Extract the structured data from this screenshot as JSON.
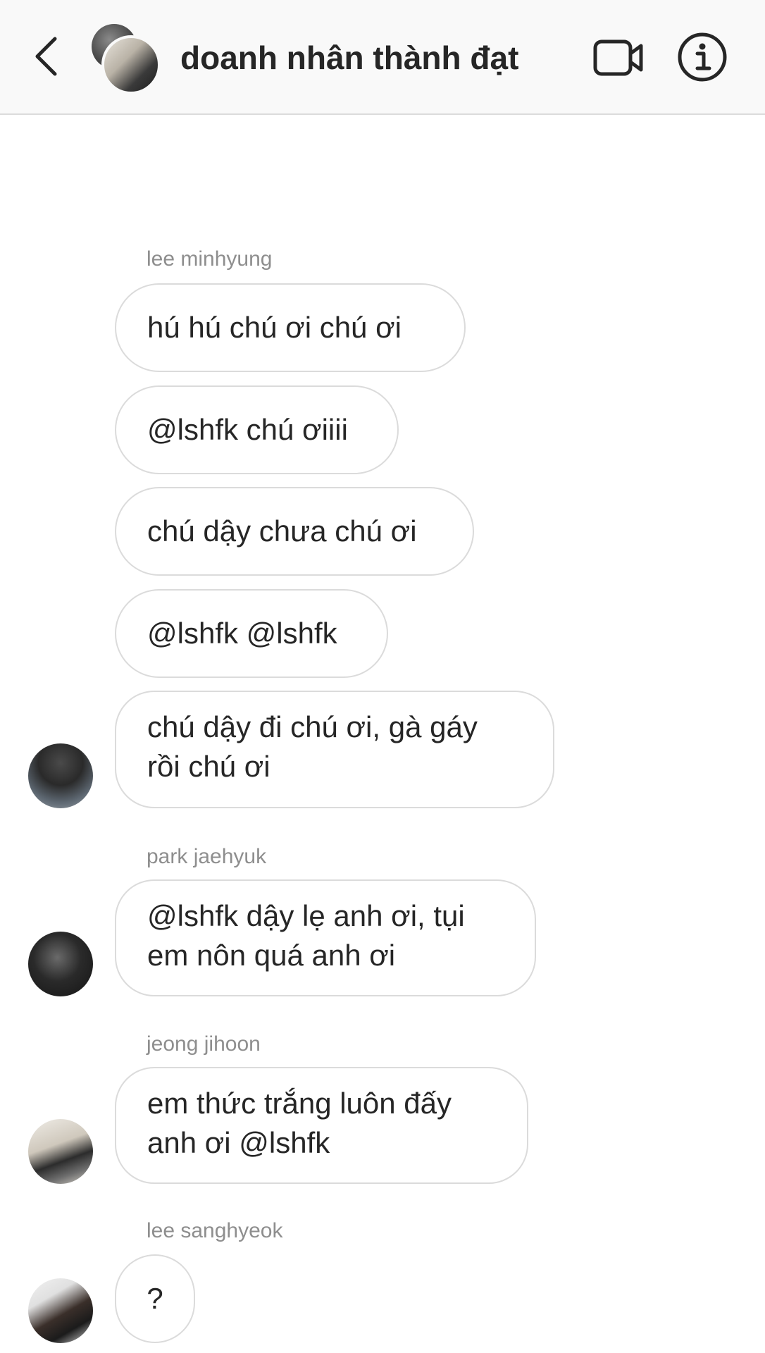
{
  "header": {
    "back_icon": "chevron-left-icon",
    "title": "doanh nhân thành đạt",
    "video_icon": "video-camera-icon",
    "info_icon": "info-icon"
  },
  "messages": [
    {
      "sender": "lee minhyung",
      "bubbles": [
        "hú hú chú ơi chú ơi",
        "@lshfk chú ơiiii",
        "chú dậy chưa chú ơi",
        "@lshfk @lshfk",
        "chú dậy đi chú ơi, gà gáy\nrồi chú ơi"
      ]
    },
    {
      "sender": "park jaehyuk",
      "bubbles": [
        "@lshfk dậy lẹ anh ơi, tụi\nem nôn quá anh ơi"
      ]
    },
    {
      "sender": "jeong jihoon",
      "bubbles": [
        "em thức trắng luôn đấy\nanh ơi @lshfk"
      ]
    },
    {
      "sender": "lee sanghyeok",
      "bubbles": [
        "?"
      ]
    }
  ]
}
